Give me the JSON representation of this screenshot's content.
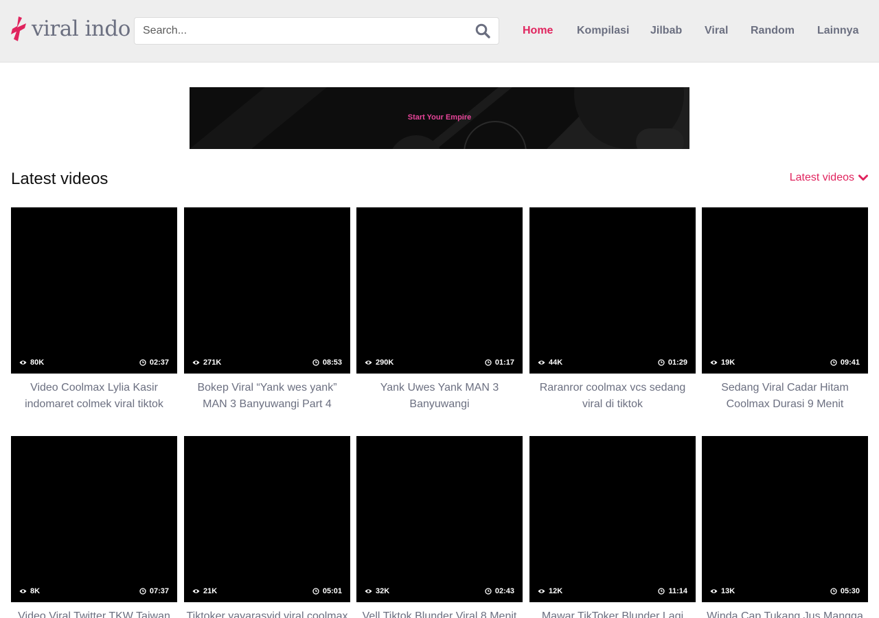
{
  "header": {
    "logo_text": "viral indo",
    "search_placeholder": "Search...",
    "nav": [
      {
        "label": "Home",
        "active": true
      },
      {
        "label": "Kompilasi",
        "active": false
      },
      {
        "label": "Jilbab",
        "active": false
      },
      {
        "label": "Viral",
        "active": false
      },
      {
        "label": "Random",
        "active": false
      },
      {
        "label": "Lainnya",
        "active": false
      }
    ]
  },
  "banner": {
    "text": "Start Your Empire"
  },
  "section": {
    "title": "Latest videos",
    "sort_label": "Latest videos"
  },
  "colors": {
    "accent": "#e0245e",
    "header_bg": "#eeeeee",
    "nav_text": "#6b6f80",
    "thumb_bg": "#000000"
  },
  "icons": {
    "search": "search-icon",
    "views": "eye-icon",
    "duration": "clock-icon",
    "sort": "chevron-down-icon"
  },
  "videos": [
    {
      "views": "80K",
      "duration": "02:37",
      "title": "Video Coolmax Lylia Kasir indomaret colmek viral tiktok"
    },
    {
      "views": "271K",
      "duration": "08:53",
      "title": "Bokep Viral “Yank wes yank” MAN 3 Banyuwangi Part 4"
    },
    {
      "views": "290K",
      "duration": "01:17",
      "title": "Yank Uwes Yank MAN 3 Banyuwangi"
    },
    {
      "views": "44K",
      "duration": "01:29",
      "title": "Raranror coolmax vcs sedang viral di tiktok"
    },
    {
      "views": "19K",
      "duration": "09:41",
      "title": "Sedang Viral Cadar Hitam Coolmax Durasi 9 Menit"
    },
    {
      "views": "8K",
      "duration": "07:37",
      "title": "Video Viral Twitter TKW Taiwan"
    },
    {
      "views": "21K",
      "duration": "05:01",
      "title": "Tiktoker yayarasyid viral coolmax"
    },
    {
      "views": "32K",
      "duration": "02:43",
      "title": "Vell Tiktok Blunder Viral 8 Menit"
    },
    {
      "views": "12K",
      "duration": "11:14",
      "title": "Mawar TikToker Blunder Lagi Live"
    },
    {
      "views": "13K",
      "duration": "05:30",
      "title": "Winda Cap Tukang Jus Mangga"
    }
  ]
}
